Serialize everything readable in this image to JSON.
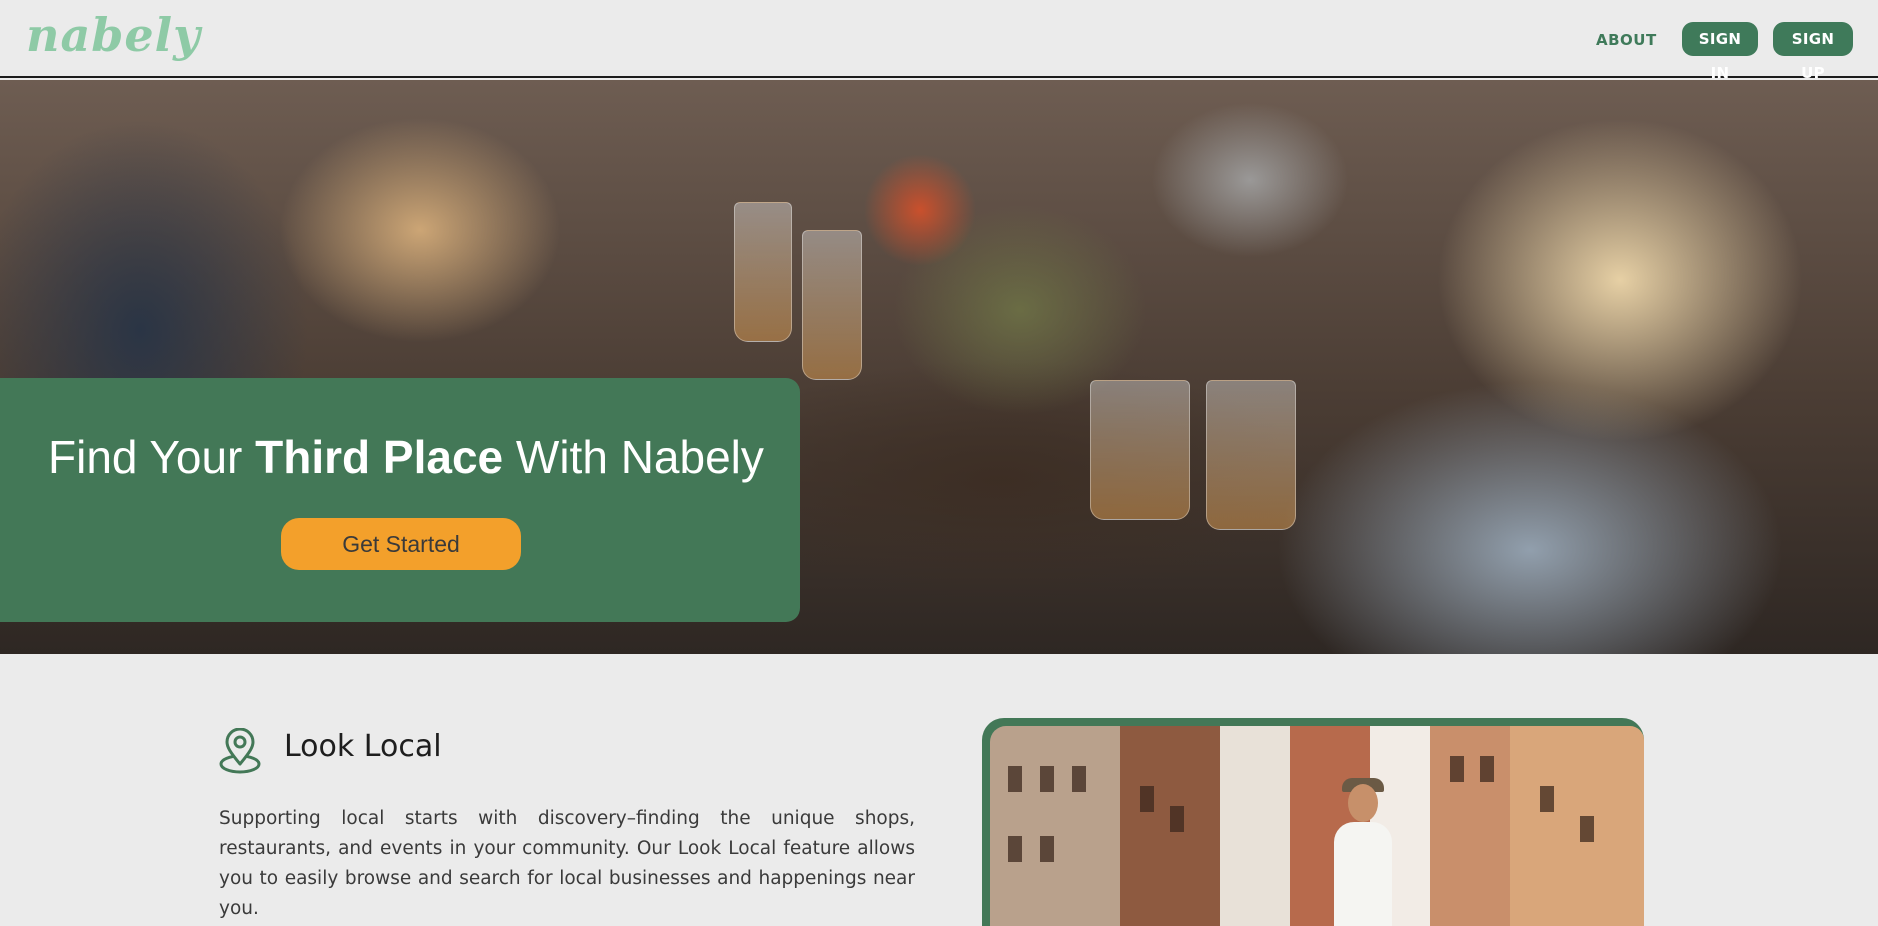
{
  "header": {
    "logo": "nabely",
    "nav": {
      "about": "ABOUT",
      "sign_in": "SIGN IN",
      "sign_up": "SIGN UP"
    }
  },
  "hero": {
    "title_prefix": "Find Your ",
    "title_bold": "Third Place",
    "title_suffix": " With Nabely",
    "cta_label": "Get Started"
  },
  "feature": {
    "icon": "location-pin-icon",
    "heading": "Look Local",
    "body": "Supporting local starts with discovery–finding the unique shops, restaurants, and events in your community. Our Look Local feature allows you to easily browse and search for local businesses and happenings near you."
  },
  "colors": {
    "brand_green": "#437857",
    "logo_green": "#8ecaa6",
    "cta_orange": "#f3a02b",
    "background": "#ebebeb"
  }
}
